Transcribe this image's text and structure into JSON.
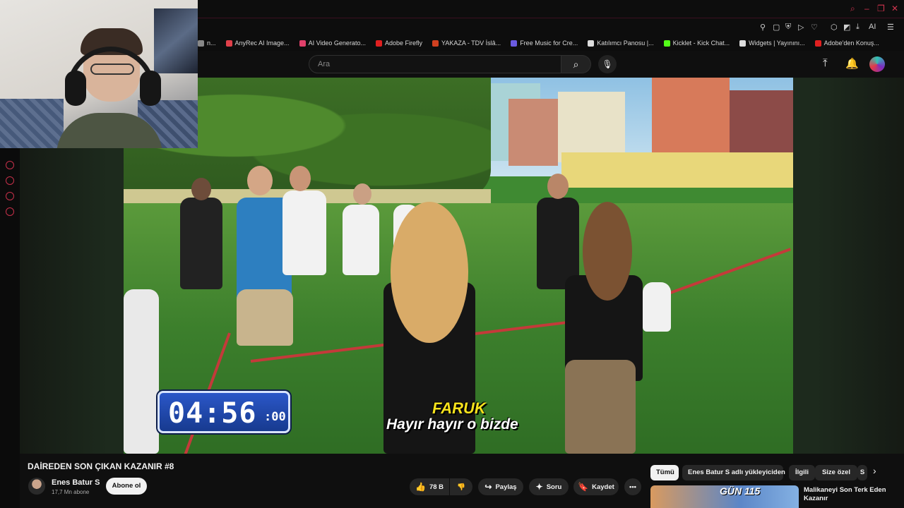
{
  "window": {
    "controls": [
      "⌕",
      "–",
      "❐",
      "✕"
    ]
  },
  "bookmarks": [
    {
      "label": "n...",
      "color": "#888888"
    },
    {
      "label": "AnyRec AI Image...",
      "color": "#e0404a"
    },
    {
      "label": "AI Video Generato...",
      "color": "#e0406a"
    },
    {
      "label": "Adobe Firefly",
      "color": "#e02020"
    },
    {
      "label": "YAKAZA - TDV İslâ...",
      "color": "#d04020"
    },
    {
      "label": "Free Music for Cre...",
      "color": "#6a5ae0"
    },
    {
      "label": "Katılımcı Panosu |...",
      "color": "#dddddd"
    },
    {
      "label": "Kicklet - Kick Chat...",
      "color": "#53fc18"
    },
    {
      "label": "Widgets | Yayınını...",
      "color": "#dddddd"
    },
    {
      "label": "Adobe'den Konuş...",
      "color": "#e02020"
    }
  ],
  "toolbar": {
    "ai_label": "AI"
  },
  "search": {
    "placeholder": "Ara"
  },
  "player": {
    "timer_main": "04:56",
    "timer_small": ":00",
    "subtitle_speaker": "FARUK",
    "subtitle_text": "Hayır hayır o bizde"
  },
  "video": {
    "title": "DAİREDEN SON ÇIKAN KAZANIR #8",
    "channel_name": "Enes Batur S",
    "subscribers": "17,7 Mn abone",
    "subscribe_label": "Abone ol",
    "likes": "78 B",
    "share_label": "Paylaş",
    "ask_label": "Soru",
    "save_label": "Kaydet",
    "more_label": "•••"
  },
  "chips": [
    {
      "label": "Tümü",
      "active": true
    },
    {
      "label": "Enes Batur S adlı yükleyiciden",
      "active": false
    },
    {
      "label": "İlgili",
      "active": false
    },
    {
      "label": "Size özel",
      "active": false
    },
    {
      "label": "S",
      "active": false
    }
  ],
  "recommended": {
    "badge": "GÜN 115",
    "title": "Malikaneyi Son Terk Eden Kazanır"
  },
  "colors": {
    "accent": "#c7304a",
    "timer_blue": "#2b57c8",
    "subtitle_yellow": "#f6e21c"
  }
}
